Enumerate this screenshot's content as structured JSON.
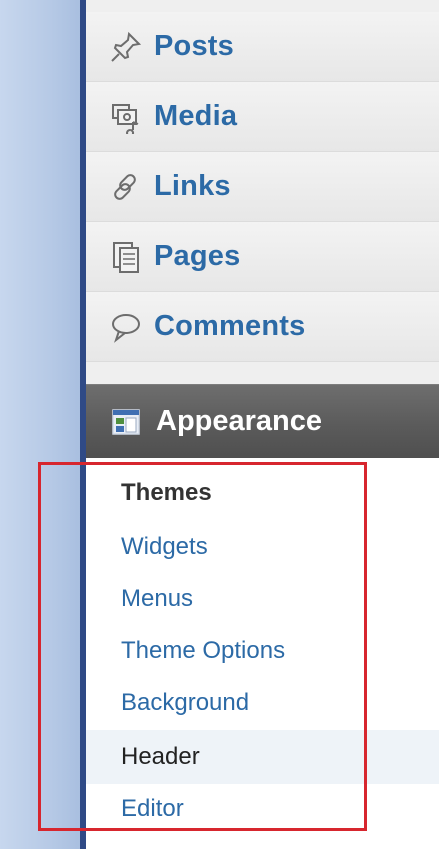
{
  "sidebar": {
    "items": [
      {
        "label": "Posts",
        "icon": "pushpin-icon"
      },
      {
        "label": "Media",
        "icon": "media-icon"
      },
      {
        "label": "Links",
        "icon": "chain-link-icon"
      },
      {
        "label": "Pages",
        "icon": "pages-icon"
      },
      {
        "label": "Comments",
        "icon": "speech-bubble-icon"
      }
    ],
    "active": {
      "label": "Appearance",
      "icon": "appearance-icon"
    },
    "submenu": [
      {
        "label": "Themes",
        "state": "current"
      },
      {
        "label": "Widgets",
        "state": "link"
      },
      {
        "label": "Menus",
        "state": "link"
      },
      {
        "label": "Theme Options",
        "state": "link"
      },
      {
        "label": "Background",
        "state": "link"
      },
      {
        "label": "Header",
        "state": "hovered"
      },
      {
        "label": "Editor",
        "state": "link"
      }
    ]
  },
  "colors": {
    "link": "#2c6aa6",
    "active_bg": "#5b5b5b",
    "highlight_border": "#d7262e",
    "left_border": "#2f4a86"
  }
}
